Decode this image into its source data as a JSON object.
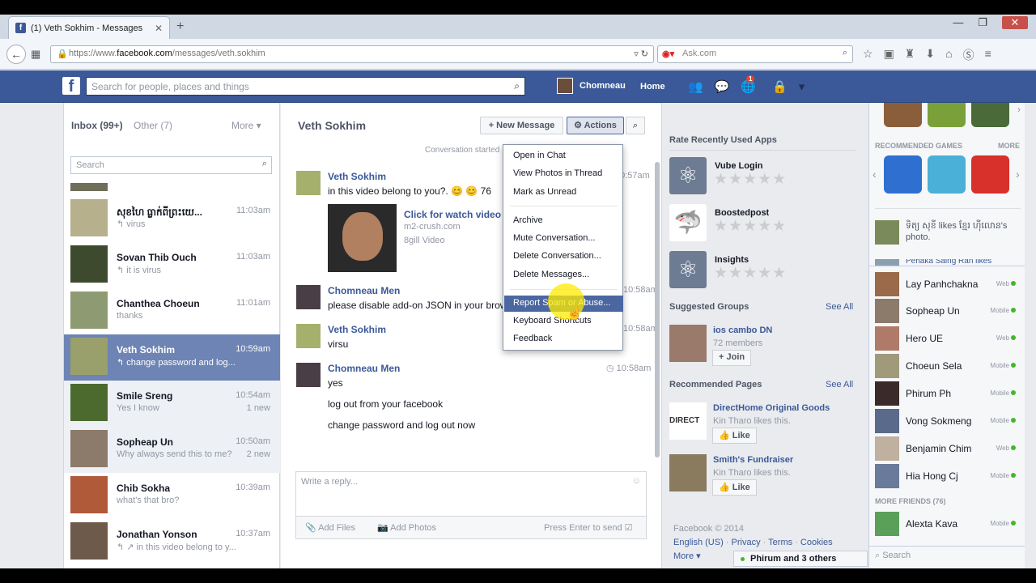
{
  "browser": {
    "tab_title": "(1) Veth Sokhim - Messages",
    "url_prefix": "https://www.",
    "url_domain": "facebook.com",
    "url_path": "/messages/veth.sokhim",
    "search_engine": "Ask.com"
  },
  "fb": {
    "search_placeholder": "Search for people, places and things",
    "user_name": "Chomneau",
    "home_label": "Home",
    "notif_count": "1"
  },
  "inbox": {
    "inbox_label": "Inbox (99+)",
    "other_label": "Other (7)",
    "more_label": "More",
    "search_placeholder": "Search",
    "conversations": [
      {
        "name": "សុខហៃ ធ្លាក់ពីព្រះយេ...",
        "preview": "virus",
        "time": "11:03am",
        "extra": ""
      },
      {
        "name": "Sovan Thib Ouch",
        "preview": "it is virus",
        "time": "11:03am",
        "extra": ""
      },
      {
        "name": "Chanthea Choeun",
        "preview": "thanks",
        "time": "11:01am",
        "extra": ""
      },
      {
        "name": "Veth Sokhim",
        "preview": "change password and log...",
        "time": "10:59am",
        "extra": ""
      },
      {
        "name": "Smile Sreng",
        "preview": "Yes I know",
        "time": "10:54am",
        "extra": "1 new"
      },
      {
        "name": "Sopheap Un",
        "preview": "Why always send this to me?",
        "time": "10:50am",
        "extra": "2 new"
      },
      {
        "name": "Chib Sokha",
        "preview": "what's that bro?",
        "time": "10:39am",
        "extra": ""
      },
      {
        "name": "Jonathan Yonson",
        "preview": "in this video belong to y...",
        "time": "10:37am",
        "extra": ""
      }
    ]
  },
  "conversation": {
    "title": "Veth Sokhim",
    "new_message_label": "+ New Message",
    "actions_label": "⚙ Actions",
    "partial_top": "Conversation started",
    "messages": [
      {
        "name": "Veth Sokhim",
        "lines": [
          "in this video belong to you?. 😊 😊 76"
        ],
        "time": "10:57am"
      },
      {
        "name": "Chomneau Men",
        "lines": [
          "please disable add-on JSON in your browser"
        ],
        "time": "10:58am"
      },
      {
        "name": "Veth Sokhim",
        "lines": [
          "virsu"
        ],
        "time": "10:58am"
      },
      {
        "name": "Chomneau Men",
        "lines": [
          "yes",
          "log out from your facebook",
          "change password and log out now"
        ],
        "time": "10:58am"
      }
    ],
    "video": {
      "link": "Click for watch video",
      "site": "m2-crush.com",
      "type": "8gill Video"
    },
    "reply_placeholder": "Write a reply...",
    "add_files": "Add Files",
    "add_photos": "Add Photos",
    "press_enter": "Press Enter to send"
  },
  "actions_menu": {
    "items": [
      "Open in Chat",
      "View Photos in Thread",
      "Mark as Unread",
      "Archive",
      "Mute Conversation...",
      "Delete Conversation...",
      "Delete Messages...",
      "Report Spam or Abuse...",
      "Keyboard Shortcuts",
      "Feedback"
    ],
    "highlighted": "Report Spam or Abuse..."
  },
  "right": {
    "rate_header": "Rate Recently Used Apps",
    "apps": [
      "Vube Login",
      "Boostedpost",
      "Insights"
    ],
    "suggested_groups": "Suggested Groups",
    "see_all": "See All",
    "group_name": "ios cambo DN",
    "group_members": "72 members",
    "join_label": "+ Join",
    "recommended_pages": "Recommended Pages",
    "pages": [
      {
        "name": "DirectHome Original Goods",
        "liker": "Kin Tharo likes this."
      },
      {
        "name": "Smith's Fundraiser",
        "liker": "Kin Tharo likes this."
      }
    ],
    "like_label": "Like",
    "footer_copy": "Facebook © 2014",
    "footer_links": [
      "English (US)",
      "Privacy",
      "Terms",
      "Cookies"
    ],
    "footer_more": "More ▾",
    "chat_tab": "Phirum and 3 others"
  },
  "chat_sidebar": {
    "recommended_games": "RECOMMENDED GAMES",
    "more": "MORE",
    "activity": "ទិត្យ សុខី likes ខ្មែរ ហ៊ីលោន's photo.",
    "partial_friend": "Pehaka Saing Ran likes",
    "friends": [
      {
        "name": "Lay Panhchakna",
        "status": "Web"
      },
      {
        "name": "Sopheap Un",
        "status": "Mobile"
      },
      {
        "name": "Hero UE",
        "status": "Web"
      },
      {
        "name": "Choeun Sela",
        "status": "Mobile"
      },
      {
        "name": "Phirum Ph",
        "status": "Mobile"
      },
      {
        "name": "Vong Sokmeng",
        "status": "Mobile"
      },
      {
        "name": "Benjamin Chim",
        "status": "Web"
      },
      {
        "name": "Hia Hong Cj",
        "status": "Mobile"
      }
    ],
    "more_friends": "MORE FRIENDS (76)",
    "more_friend": {
      "name": "Alexta Kava",
      "status": "Mobile"
    },
    "search_placeholder": "Search"
  }
}
